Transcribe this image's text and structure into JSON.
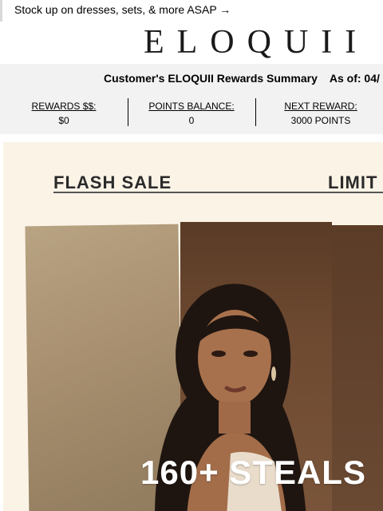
{
  "preheader": {
    "text": "Stock up on dresses, sets, & more ASAP →"
  },
  "brand": {
    "logo_text": "ELOQUII"
  },
  "rewards": {
    "summary_title": "Customer's ELOQUII Rewards Summary",
    "as_of": "As of: 04/",
    "stats": [
      {
        "label": "REWARDS $$:",
        "value": "$0"
      },
      {
        "label": "POINTS BALANCE:",
        "value": "0"
      },
      {
        "label": "NEXT REWARD:",
        "value": "3000 POINTS"
      }
    ]
  },
  "hero": {
    "flash_sale": "FLASH SALE",
    "limit": "LIMIT",
    "steals": "160+ STEALS"
  },
  "colors": {
    "band_bg": "#f2f2f2",
    "hero_bg": "#fbf3e6",
    "text": "#000000"
  }
}
